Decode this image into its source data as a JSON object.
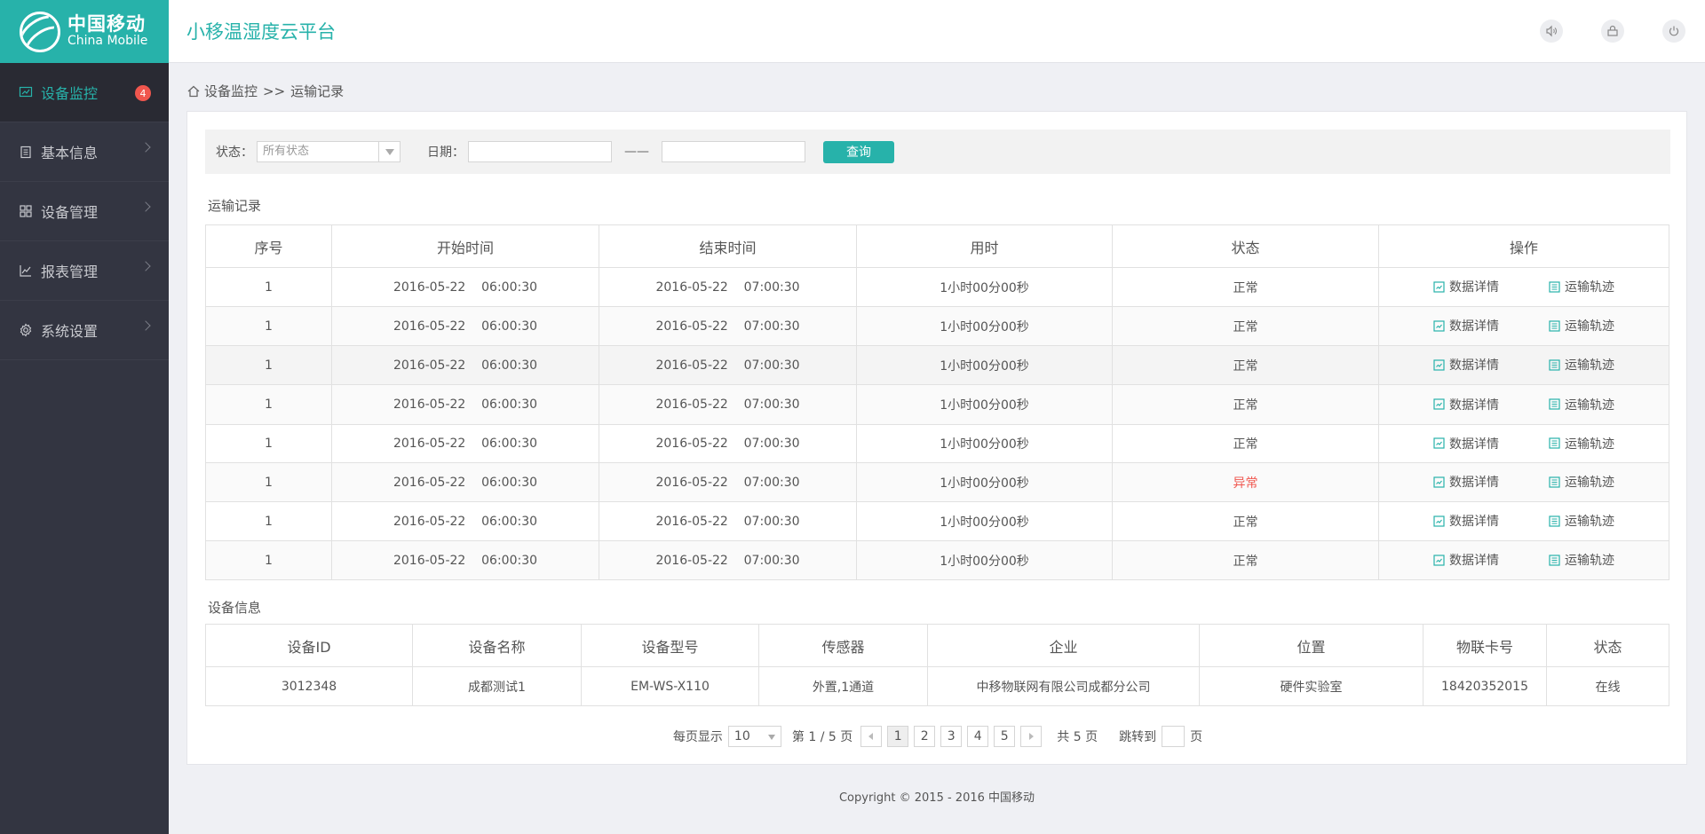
{
  "brand": {
    "cn": "中国移动",
    "en": "China Mobile"
  },
  "app_title": "小移温湿度云平台",
  "sidebar": {
    "items": [
      {
        "label": "设备监控",
        "icon": "monitor-chart-icon",
        "badge": "4",
        "active": true
      },
      {
        "label": "基本信息",
        "icon": "clipboard-icon"
      },
      {
        "label": "设备管理",
        "icon": "grid-icon"
      },
      {
        "label": "报表管理",
        "icon": "line-chart-icon"
      },
      {
        "label": "系统设置",
        "icon": "gear-icon"
      }
    ]
  },
  "header_icons": [
    "speaker-icon",
    "user-lock-icon",
    "power-icon"
  ],
  "breadcrumb": {
    "parent": "设备监控",
    "sep": ">>",
    "current": "运输记录"
  },
  "filter": {
    "status_label": "状态：",
    "status_value": "所有状态",
    "date_label": "日期：",
    "dash": "——",
    "query_label": "查询"
  },
  "transport": {
    "title": "运输记录",
    "headers": [
      "序号",
      "开始时间",
      "结束时间",
      "用时",
      "状态",
      "操作"
    ],
    "rows": [
      {
        "no": "1",
        "start": "2016-05-22    06:00:30",
        "end": "2016-05-22    07:00:30",
        "duration": "1小时00分00秒",
        "status": "正常"
      },
      {
        "no": "1",
        "start": "2016-05-22    06:00:30",
        "end": "2016-05-22    07:00:30",
        "duration": "1小时00分00秒",
        "status": "正常"
      },
      {
        "no": "1",
        "start": "2016-05-22    06:00:30",
        "end": "2016-05-22    07:00:30",
        "duration": "1小时00分00秒",
        "status": "正常"
      },
      {
        "no": "1",
        "start": "2016-05-22    06:00:30",
        "end": "2016-05-22    07:00:30",
        "duration": "1小时00分00秒",
        "status": "正常"
      },
      {
        "no": "1",
        "start": "2016-05-22    06:00:30",
        "end": "2016-05-22    07:00:30",
        "duration": "1小时00分00秒",
        "status": "正常"
      },
      {
        "no": "1",
        "start": "2016-05-22    06:00:30",
        "end": "2016-05-22    07:00:30",
        "duration": "1小时00分00秒",
        "status": "异常"
      },
      {
        "no": "1",
        "start": "2016-05-22    06:00:30",
        "end": "2016-05-22    07:00:30",
        "duration": "1小时00分00秒",
        "status": "正常"
      },
      {
        "no": "1",
        "start": "2016-05-22    06:00:30",
        "end": "2016-05-22    07:00:30",
        "duration": "1小时00分00秒",
        "status": "正常"
      }
    ],
    "op_detail": "数据详情",
    "op_track": "运输轨迹"
  },
  "device": {
    "title": "设备信息",
    "headers": [
      "设备ID",
      "设备名称",
      "设备型号",
      "传感器",
      "企业",
      "位置",
      "物联卡号",
      "状态"
    ],
    "row": [
      "3012348",
      "成都测试1",
      "EM-WS-X110",
      "外置,1通道",
      "中移物联网有限公司成都分公司",
      "硬件实验室",
      "18420352015",
      "在线"
    ]
  },
  "pager": {
    "per_page_label": "每页显示",
    "per_page_value": "10",
    "page_info": "第 1 / 5 页",
    "pages": [
      "1",
      "2",
      "3",
      "4",
      "5"
    ],
    "total": "共 5 页",
    "jump_label": "跳转到",
    "page_unit": "页"
  },
  "footer": "Copyright © 2015 - 2016 中国移动",
  "colors": {
    "accent": "#27b2aa",
    "sidebar": "#333541",
    "warn": "#f0564e"
  }
}
